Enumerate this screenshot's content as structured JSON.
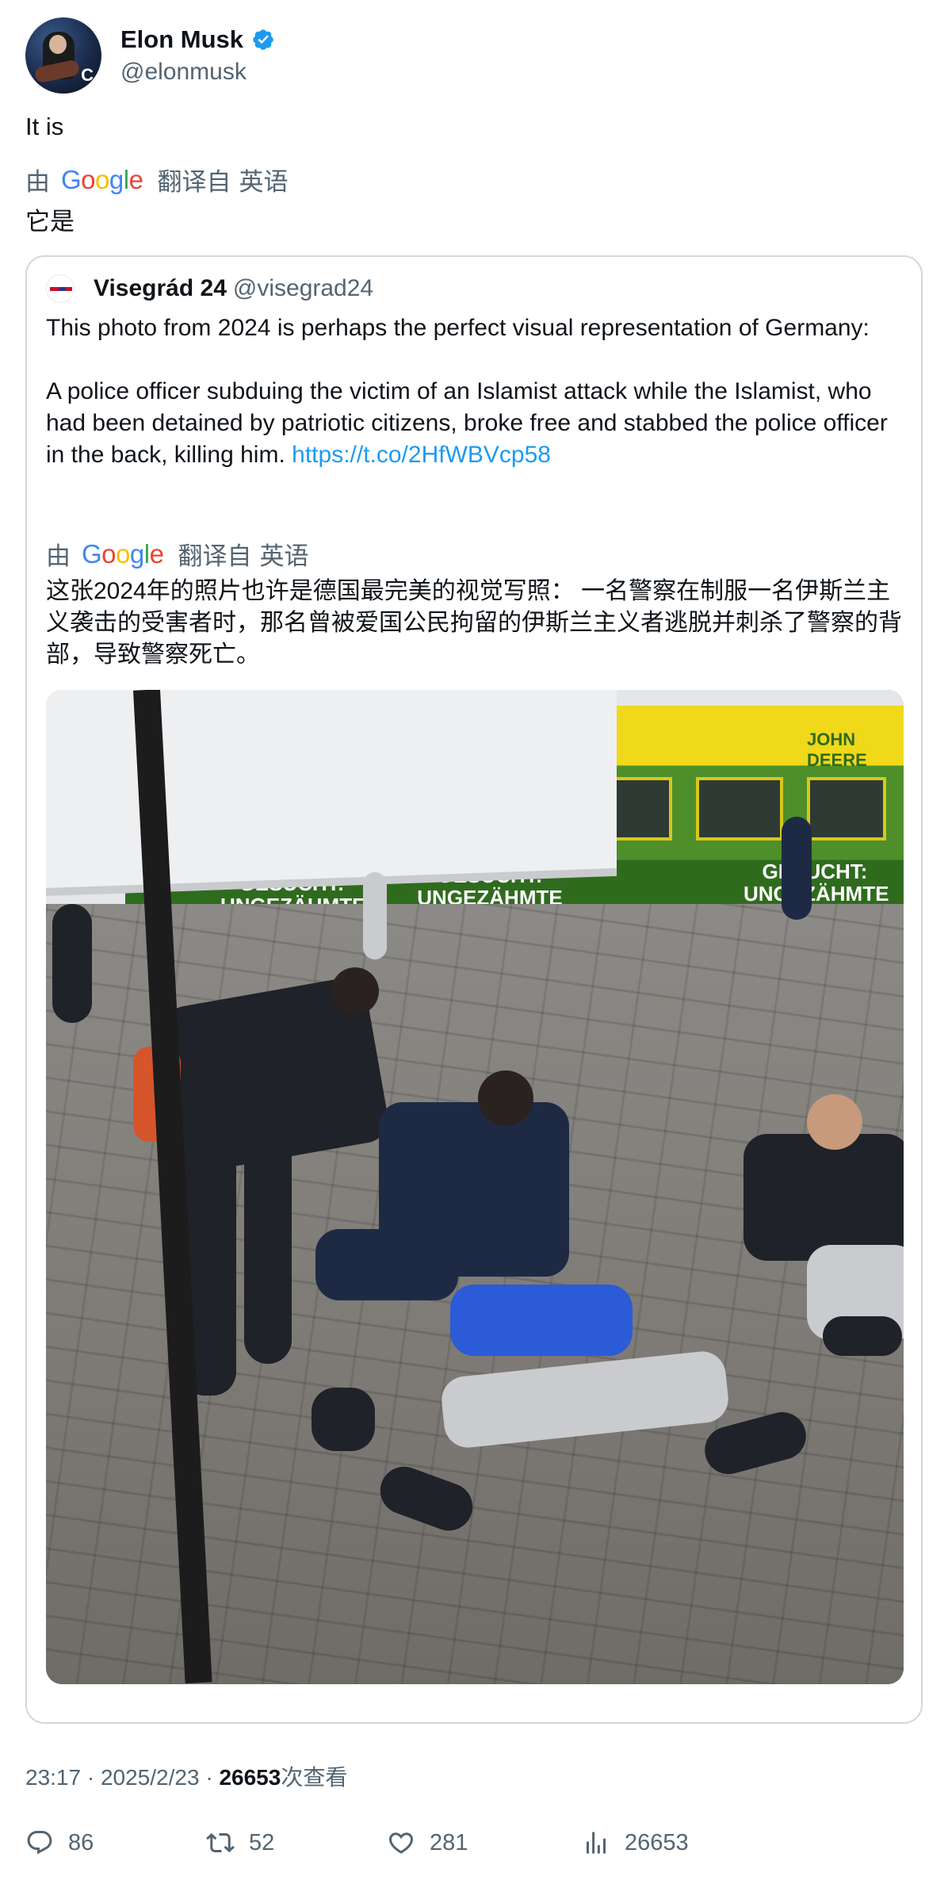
{
  "author": {
    "name": "Elon Musk",
    "handle": "@elonmusk",
    "verified": true,
    "accent_color": "#1d9bf0"
  },
  "tweet": {
    "text": "It is",
    "translation": {
      "by": "由",
      "provider": "Google",
      "from_label": "翻译自",
      "language": "英语",
      "text": "它是"
    }
  },
  "quote": {
    "name": "Visegrád 24",
    "handle": "@visegrad24",
    "paragraph1": "This photo from 2024 is perhaps the perfect visual representation of Germany:",
    "paragraph2": "A police officer subduing the victim of an Islamist attack while the Islamist, who had been detained by patriotic citizens, broke free and stabbed the police officer in the back, killing him.",
    "link": "https://t.co/2HfWBVcp58",
    "translation": {
      "by": "由",
      "provider": "Google",
      "from_label": "翻译自",
      "language": "英语",
      "text": "这张2024年的照片也许是德国最完美的视觉写照： 一名警察在制服一名伊斯兰主义袭击的受害者时，那名曾被爱国公民拘留的伊斯兰主义者逃脱并刺杀了警察的背部，导致警察死亡。"
    },
    "photo": {
      "tram_logo_text": "JOHN DEERE",
      "tram_ad_texts": [
        "GESUCHT: UNGEZÄHMTE POWER",
        "GESUCHT: UNGEZÄHMTE POWER",
        "GESUCHT: UNGEZÄHMTE POWER"
      ]
    }
  },
  "meta": {
    "time": "23:17",
    "date": "2025/2/23",
    "views": "26653",
    "views_label": "次查看"
  },
  "actions": {
    "replies": "86",
    "retweets": "52",
    "likes": "281",
    "views": "26653"
  }
}
